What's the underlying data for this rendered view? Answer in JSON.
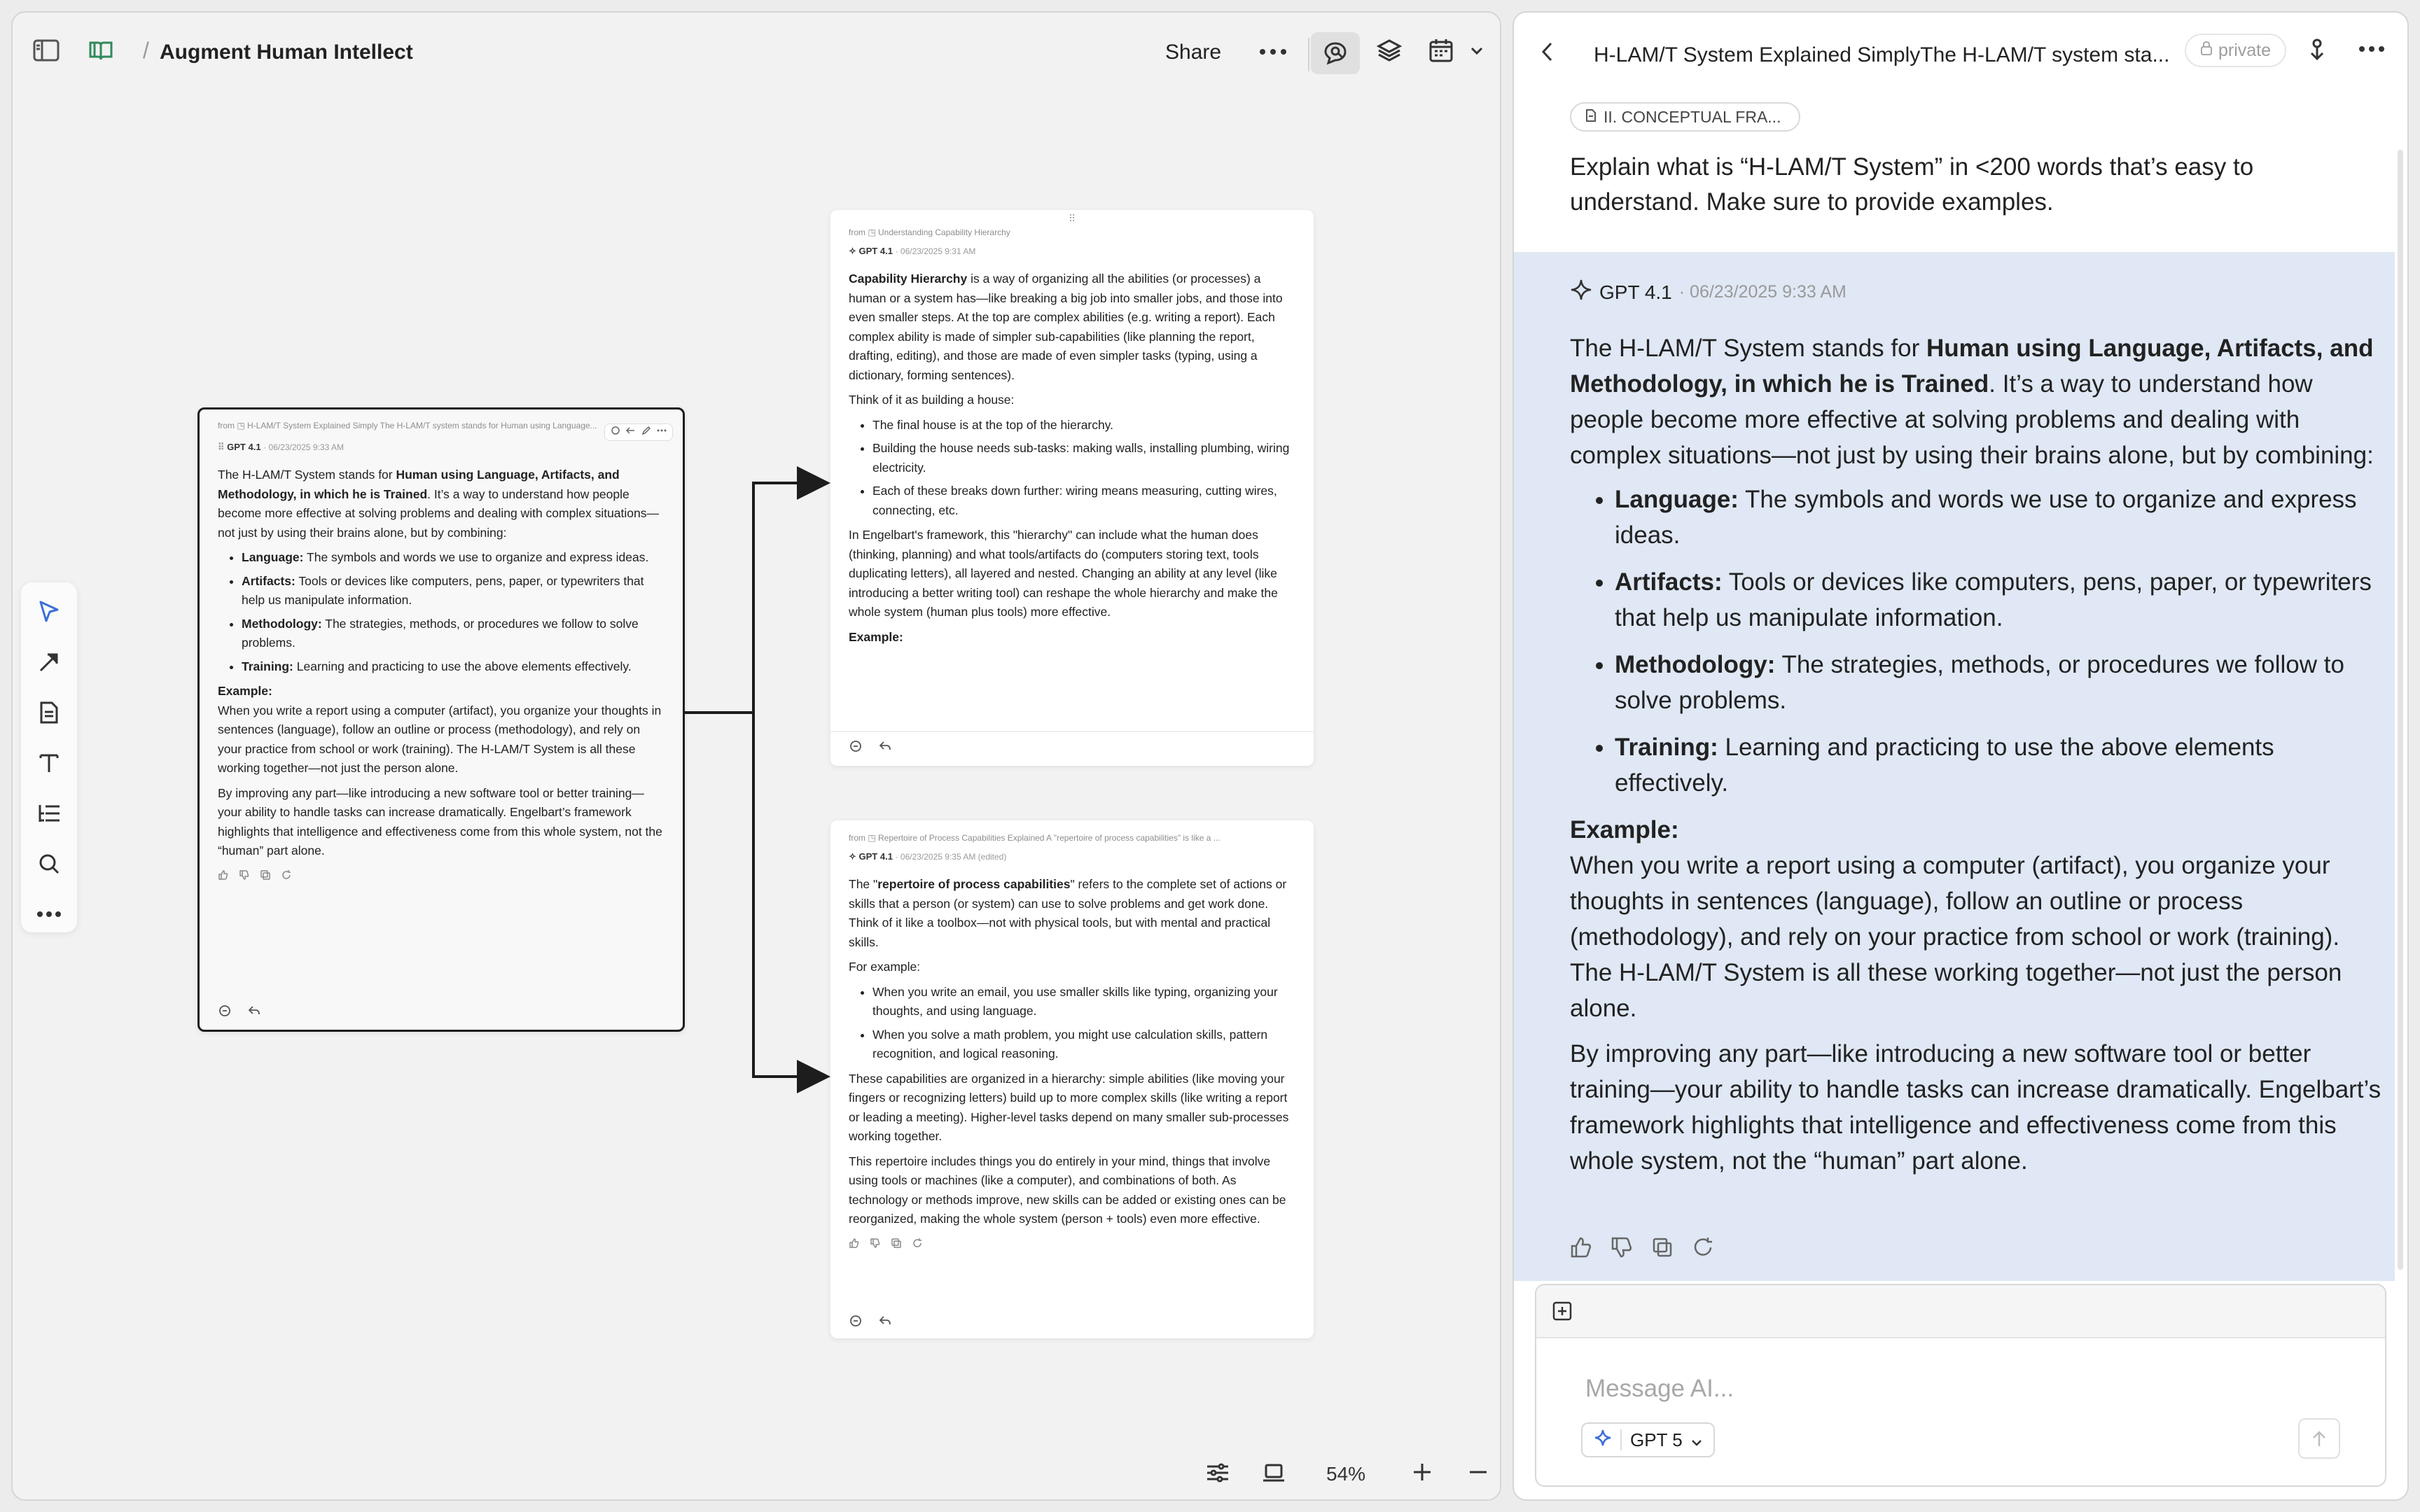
{
  "header": {
    "doc_title": "Augment Human Intellect",
    "breadcrumb_sep": "/",
    "share_label": "Share"
  },
  "cards": {
    "main": {
      "from": "from ◳ H-LAM/T System Explained Simply The H-LAM/T system stands for Human using Language...",
      "model": "GPT 4.1",
      "date": "· 06/23/2025 9:33 AM",
      "intro_a": "The H-LAM/T System stands for ",
      "intro_bold": "Human using Language, Artifacts, and Methodology, in which he is Trained",
      "intro_b": ". It’s a way to understand how people become more effective at solving problems and dealing with complex situations—not just by using their brains alone, but by combining:",
      "bullets": [
        {
          "term": "Language:",
          "text": " The symbols and words we use to organize and express ideas."
        },
        {
          "term": "Artifacts:",
          "text": " Tools or devices like computers, pens, paper, or typewriters that help us manipulate information."
        },
        {
          "term": "Methodology:",
          "text": " The strategies, methods, or procedures we follow to solve problems."
        },
        {
          "term": "Training:",
          "text": " Learning and practicing to use the above elements effectively."
        }
      ],
      "example_head": "Example:",
      "example": "When you write a report using a computer (artifact), you organize your thoughts in sentences (language), follow an outline or process (methodology), and rely on your practice from school or work (training). The H-LAM/T System is all these working together—not just the person alone.",
      "closing": "By improving any part—like introducing a new software tool or better training—your ability to handle tasks can increase dramatically. Engelbart’s framework highlights that intelligence and effectiveness come from this whole system, not the “human” part alone."
    },
    "capability": {
      "from": "from ◳ Understanding Capability Hierarchy",
      "model": "GPT 4.1",
      "date": "· 06/23/2025 9:31 AM",
      "intro_bold": "Capability Hierarchy",
      "intro": " is a way of organizing all the abilities (or processes) a human or a system has—like breaking a big job into smaller jobs, and those into even smaller steps. At the top are complex abilities (e.g. writing a report). Each complex ability is made of simpler sub-capabilities (like planning the report, drafting, editing), and those are made of even simpler tasks (typing, using a dictionary, forming sentences).",
      "think": "Think of it as building a house:",
      "bullets": [
        "The final house is at the top of the hierarchy.",
        "Building the house needs sub-tasks: making walls, installing plumbing, wiring electricity.",
        "Each of these breaks down further: wiring means measuring, cutting wires, connecting, etc."
      ],
      "para": "In Engelbart's framework, this \"hierarchy\" can include what the human does (thinking, planning) and what tools/artifacts do (computers storing text, tools duplicating letters), all layered and nested. Changing an ability at any level (like introducing a better writing tool) can reshape the whole hierarchy and make the whole system (human plus tools) more effective.",
      "example_head": "Example:"
    },
    "repertoire": {
      "from": "from ◳ Repertoire of Process Capabilities Explained A \"repertoire of process capabilities\" is like a ...",
      "model": "GPT 4.1",
      "date": "· 06/23/2025 9:35 AM (edited)",
      "intro_a": "The \"",
      "intro_bold": "repertoire of process capabilities",
      "intro_b": "\" refers to the complete set of actions or skills that a person (or system) can use to solve problems and get work done. Think of it like a toolbox—not with physical tools, but with mental and practical skills.",
      "for_example": "For example:",
      "bullets": [
        "When you write an email, you use smaller skills like typing, organizing your thoughts, and using language.",
        "When you solve a math problem, you might use calculation skills, pattern recognition, and logical reasoning."
      ],
      "para1": "These capabilities are organized in a hierarchy: simple abilities (like moving your fingers or recognizing letters) build up to more complex skills (like writing a report or leading a meeting). Higher-level tasks depend on many smaller sub-processes working together.",
      "para2": "This repertoire includes things you do entirely in your mind, things that involve using tools or machines (like a computer), and combinations of both. As technology or methods improve, new skills can be added or existing ones can be reorganized, making the whole system (person + tools) even more effective."
    }
  },
  "bottom": {
    "zoom": "54%"
  },
  "chat": {
    "title": "H-LAM/T System Explained SimplyThe H-LAM/T system sta...",
    "private_label": "private",
    "section_chip": "II. CONCEPTUAL FRA...",
    "user_message": "Explain what is “H-LAM/T System” in <200 words that’s easy to understand. Make sure to provide examples.",
    "model": "GPT 4.1",
    "date": "· 06/23/2025 9:33 AM",
    "intro_a": "The H-LAM/T System stands for ",
    "intro_bold": "Human using Language, Artifacts, and Methodology, in which he is Trained",
    "intro_b": ". It’s a way to understand how people become more effective at solving problems and dealing with complex situations—not just by using their brains alone, but by combining:",
    "bullets": [
      {
        "term": "Language:",
        "text": " The symbols and words we use to organize and express ideas."
      },
      {
        "term": "Artifacts:",
        "text": " Tools or devices like computers, pens, paper, or typewriters that help us manipulate information."
      },
      {
        "term": "Methodology:",
        "text": " The strategies, methods, or procedures we follow to solve problems."
      },
      {
        "term": "Training:",
        "text": " Learning and practicing to use the above elements effectively."
      }
    ],
    "example_head": "Example:",
    "example": "When you write a report using a computer (artifact), you organize your thoughts in sentences (language), follow an outline or process (methodology), and rely on your practice from school or work (training). The H-LAM/T System is all these working together—not just the person alone.",
    "closing": "By improving any part—like introducing a new software tool or better training—your ability to handle tasks can increase dramatically. Engelbart’s framework highlights that intelligence and effectiveness come from this whole system, not the “human” part alone.",
    "input_placeholder": "Message AI...",
    "selected_model": "GPT 5"
  },
  "colors": {
    "ai_response_bg": "#dfe8f4",
    "selected_tool": "#3b6fd8",
    "book_icon": "#2f8a5b"
  },
  "icons": [
    "sidebar-toggle-icon",
    "book-icon",
    "more-icon",
    "chat-icon",
    "layers-icon",
    "calendar-icon",
    "chevron-down-icon",
    "pointer-icon",
    "connector-icon",
    "note-icon",
    "text-icon",
    "outline-icon",
    "search-icon",
    "sliders-icon",
    "laptop-icon",
    "plus-icon",
    "minus-icon",
    "back-icon",
    "lock-icon",
    "share-icon",
    "document-icon",
    "sparkle-icon",
    "thumbs-up-icon",
    "thumbs-down-icon",
    "copy-icon",
    "refresh-icon",
    "add-context-icon",
    "send-icon"
  ]
}
